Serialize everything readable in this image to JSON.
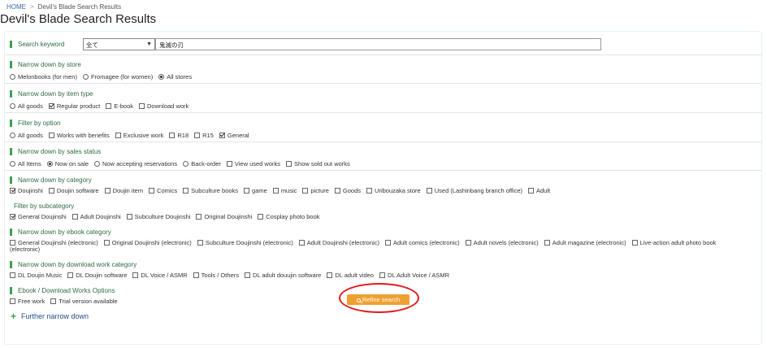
{
  "breadcrumb": {
    "home": "HOME",
    "separator": ">",
    "current": "Devil's Blade Search Results"
  },
  "page_title": "Devil's Blade Search Results",
  "keyword": {
    "label": "Search keyword",
    "select_value": "全て",
    "input_value": "鬼滅の刃"
  },
  "store": {
    "label": "Narrow down by store",
    "options": [
      {
        "label": "Melonbooks (for men)",
        "checked": false
      },
      {
        "label": "Fromagee (for women)",
        "checked": false
      },
      {
        "label": "All stores",
        "checked": true
      }
    ]
  },
  "item_type": {
    "label": "Narrow down by item type",
    "options": [
      {
        "label": "All goods",
        "checked": false,
        "kind": "radio"
      },
      {
        "label": "Regular product",
        "checked": true,
        "kind": "check"
      },
      {
        "label": "E-book",
        "checked": false,
        "kind": "check"
      },
      {
        "label": "Download work",
        "checked": false,
        "kind": "check"
      }
    ]
  },
  "option_filter": {
    "label": "Filter by option",
    "options": [
      {
        "label": "All goods",
        "checked": false,
        "kind": "radio"
      },
      {
        "label": "Works with benefits",
        "checked": false,
        "kind": "check"
      },
      {
        "label": "Exclusive work",
        "checked": false,
        "kind": "check"
      },
      {
        "label": "R18",
        "checked": false,
        "kind": "check"
      },
      {
        "label": "R15",
        "checked": false,
        "kind": "check"
      },
      {
        "label": "General",
        "checked": true,
        "kind": "check"
      }
    ]
  },
  "sales_status": {
    "label": "Narrow down by sales status",
    "options": [
      {
        "label": "All Items",
        "checked": false,
        "kind": "radio"
      },
      {
        "label": "Now on sale",
        "checked": true,
        "kind": "radio"
      },
      {
        "label": "Now accepting reservations",
        "checked": false,
        "kind": "radio"
      },
      {
        "label": "Back-order",
        "checked": false,
        "kind": "radio"
      },
      {
        "label": "View used works",
        "checked": false,
        "kind": "check"
      },
      {
        "label": "Show sold out works",
        "checked": false,
        "kind": "check"
      }
    ]
  },
  "category": {
    "label": "Narrow down by category",
    "options": [
      {
        "label": "Doujinshi",
        "checked": true
      },
      {
        "label": "Doujin software",
        "checked": false
      },
      {
        "label": "Doujin item",
        "checked": false
      },
      {
        "label": "Comics",
        "checked": false
      },
      {
        "label": "Subculture books",
        "checked": false
      },
      {
        "label": "game",
        "checked": false
      },
      {
        "label": "music",
        "checked": false
      },
      {
        "label": "picture",
        "checked": false
      },
      {
        "label": "Goods",
        "checked": false
      },
      {
        "label": "Uribouzaka store",
        "checked": false
      },
      {
        "label": "Used (Lashinbang branch office)",
        "checked": false
      },
      {
        "label": "Adult",
        "checked": false
      }
    ]
  },
  "subcategory": {
    "label": "Filter by subcategory",
    "options": [
      {
        "label": "General Doujinshi",
        "checked": true
      },
      {
        "label": "Adult Doujinshi",
        "checked": false
      },
      {
        "label": "Subculture Doujinshi",
        "checked": false
      },
      {
        "label": "Original Doujinshi",
        "checked": false
      },
      {
        "label": "Cosplay photo book",
        "checked": false
      }
    ]
  },
  "ebook_category": {
    "label": "Narrow down by ebook category",
    "options": [
      {
        "label": "General Doujinshi (electronic)",
        "checked": false
      },
      {
        "label": "Original Doujinshi (electronic)",
        "checked": false
      },
      {
        "label": "Subculture Doujinshi (electronic)",
        "checked": false
      },
      {
        "label": "Adult Doujinshi (electronic)",
        "checked": false
      },
      {
        "label": "Adult comics (electronic)",
        "checked": false
      },
      {
        "label": "Adult novels (electronic)",
        "checked": false
      },
      {
        "label": "Adult magazine (electronic)",
        "checked": false
      },
      {
        "label": "Live-action adult photo book",
        "checked": false
      }
    ],
    "wrap_text": "(electronic)"
  },
  "download_category": {
    "label": "Narrow down by download work category",
    "options": [
      {
        "label": "DL Doujin Music",
        "checked": false
      },
      {
        "label": "DL Doujin software",
        "checked": false
      },
      {
        "label": "DL Voice / ASMR",
        "checked": false
      },
      {
        "label": "Tools / Others",
        "checked": false
      },
      {
        "label": "DL adult douujin software",
        "checked": false
      },
      {
        "label": "DL adult video",
        "checked": false
      },
      {
        "label": "DL Adult Voice / ASMR",
        "checked": false
      }
    ]
  },
  "ebook_download_options": {
    "label": "Ebook / Download Works Options",
    "options": [
      {
        "label": "Free work",
        "checked": false
      },
      {
        "label": "Trial version available",
        "checked": false
      }
    ]
  },
  "further": {
    "icon": "plus-icon",
    "label": "Further narrow down"
  },
  "refine": {
    "icon": "search-icon",
    "label": "Refine search"
  },
  "colors": {
    "accent_green": "#3aa055",
    "heading_green": "#2f6b45",
    "button_orange": "#f0a030",
    "highlight_red": "#e11a1a",
    "panel_bg": "#e8f3ef"
  }
}
